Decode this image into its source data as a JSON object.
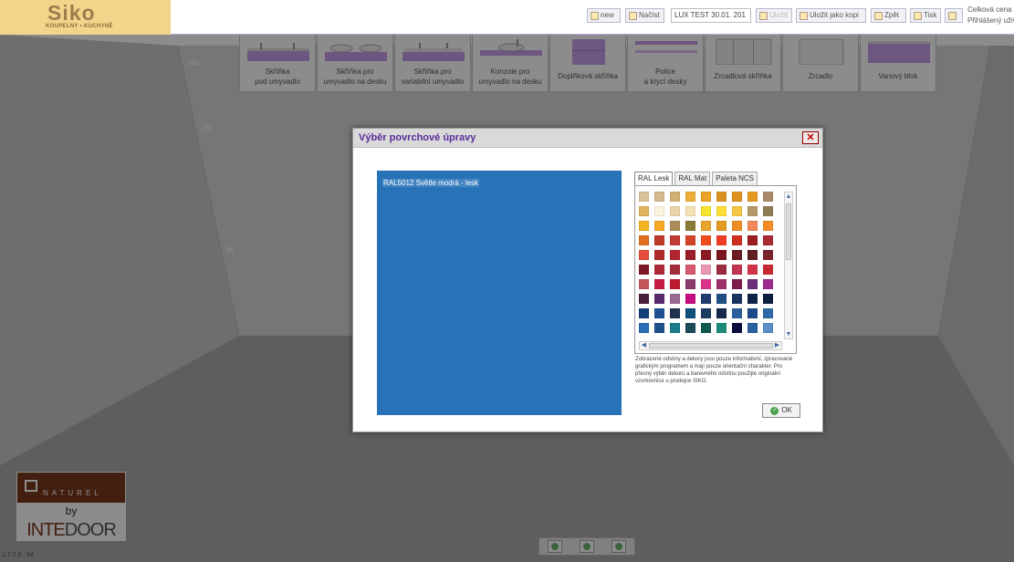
{
  "header": {
    "brand": "Siko",
    "brand_sub": "KOUPELNY • KUCHYNĚ",
    "buttons": {
      "new": "new",
      "load": "Načíst",
      "save": "Uložit",
      "save_as": "Uložit jako kopi",
      "back": "Zpět",
      "print": "Tisk"
    },
    "project_name": "LUX TEST 30.01. 201",
    "price_label": "Celková cena",
    "login_label": "Přihlášený uživ"
  },
  "tiles": [
    {
      "line1": "Skříňka",
      "line2": "pod umyvadlo"
    },
    {
      "line1": "Skříňka pro",
      "line2": "umyvadlo na desku"
    },
    {
      "line1": "Skříňka pro",
      "line2": "variabilní umyvadlo"
    },
    {
      "line1": "Konzole pro",
      "line2": "umyvadlo na desku"
    },
    {
      "line1": "Doplňková skříňka",
      "line2": ""
    },
    {
      "line1": "Police",
      "line2": "a krycí desky"
    },
    {
      "line1": "Zrcadlová skříňka",
      "line2": ""
    },
    {
      "line1": "Zrcadlo",
      "line2": ""
    },
    {
      "line1": "Vanový blok",
      "line2": ""
    }
  ],
  "ruler": {
    "r240": "240",
    "r190": "190",
    "r85": "85"
  },
  "dialog": {
    "title": "Výběr povrchové úpravy",
    "close_label": "✕",
    "selected_color_label": "RAL5012 Světle modrá - lesk",
    "selected_color_hex": "#2873b8",
    "tabs": [
      "RAL Lesk",
      "RAL Mat",
      "Paleta NCS"
    ],
    "active_tab": "RAL Lesk",
    "swatches": [
      "#d8c39b",
      "#d6b98d",
      "#d4b074",
      "#ecae36",
      "#eba328",
      "#d99020",
      "#e0901f",
      "#e59a1f",
      "#ab8a6c",
      "#e0b45d",
      "#fbf4dd",
      "#ecd4aa",
      "#f4e1b4",
      "#f6e630",
      "#ffde35",
      "#f5c742",
      "#b79a6a",
      "#8f7d55",
      "#f2b420",
      "#f6a724",
      "#ac8c5a",
      "#8a7a3a",
      "#e8a42b",
      "#e29c23",
      "#ed8d24",
      "#f08858",
      "#f58b26",
      "#e0701e",
      "#bf3a2a",
      "#c23a31",
      "#d3442a",
      "#f24b1e",
      "#ee3d24",
      "#d02f20",
      "#9b1b1f",
      "#a92a34",
      "#e64d3a",
      "#ae2b2a",
      "#b32530",
      "#9a1f2a",
      "#8a1a24",
      "#7c171f",
      "#6c1b22",
      "#611d20",
      "#7b252a",
      "#7e1a25",
      "#ad2b38",
      "#a32e3b",
      "#d6586d",
      "#e898b3",
      "#9b2a3e",
      "#c23652",
      "#d23548",
      "#c72a30",
      "#c4575c",
      "#c41e44",
      "#bf1932",
      "#8b3b6c",
      "#d9348a",
      "#a0326b",
      "#7b1d4d",
      "#6d2f7a",
      "#9c2a8e",
      "#4a1f3c",
      "#5a2a6e",
      "#9a6a92",
      "#c70e82",
      "#1e3a6e",
      "#1d4f82",
      "#16345e",
      "#0f2348",
      "#0c1d3e",
      "#153f7a",
      "#1e5293",
      "#1f3050",
      "#0e4f7c",
      "#1c3b63",
      "#17294a",
      "#2a5f9c",
      "#1b4a8a",
      "#2e6aa8",
      "#2a6db6",
      "#1f4f8c",
      "#1a7c8a",
      "#1d4a5a",
      "#0e5a4e",
      "#1a8a7a",
      "#0b0e3c",
      "#2c5fa0",
      "#5a90c4"
    ],
    "disclaimer": "Zobrazené odstíny a dekory jsou pouze informativní, zpracované grafickým programem a mají pouze orientační charakter. Pro přesný výběr dekoru a barevného odstínu použijte originální vzorkovnice u prodejce SIKO.",
    "ok_label": "OK"
  },
  "brand_logo": {
    "top": "NATUREL",
    "by": "by",
    "inte": "INTE",
    "door": "DOOR"
  },
  "version": "1.7.2.8 : 64"
}
